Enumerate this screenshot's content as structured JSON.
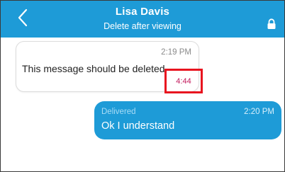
{
  "header": {
    "title": "Lisa Davis",
    "subtitle": "Delete after viewing",
    "back_icon": "chevron-left-icon",
    "lock_icon": "lock-icon",
    "background_color": "#1e9bd7"
  },
  "messages": [
    {
      "direction": "incoming",
      "time": "2:19 PM",
      "text": "This message should be deleted",
      "countdown": "4:44"
    },
    {
      "direction": "outgoing",
      "status": "Delivered",
      "time": "2:20 PM",
      "text": "Ok I understand"
    }
  ],
  "colors": {
    "accent": "#1e9bd7",
    "highlight_box": "#e8141f",
    "countdown_text": "#c2185b"
  }
}
